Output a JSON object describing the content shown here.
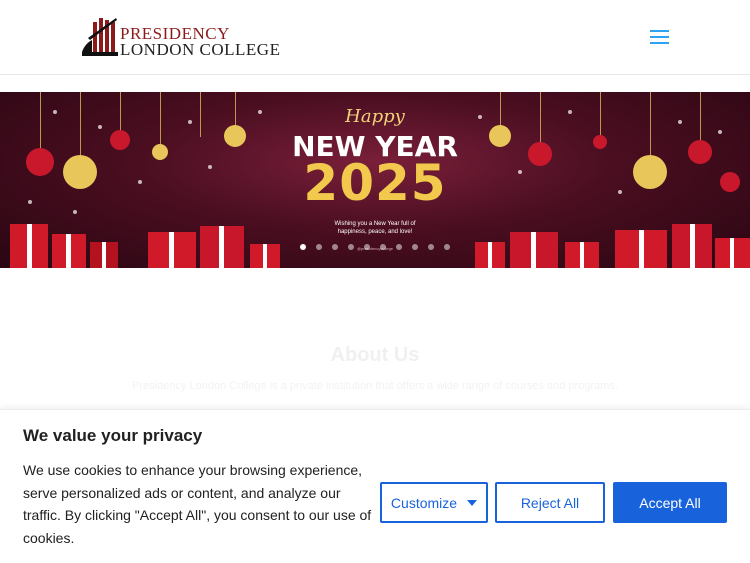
{
  "header": {
    "logo_line1": "PRESIDENCY",
    "logo_line2": "LONDON COLLEGE",
    "menu_icon": "hamburger-menu-icon"
  },
  "slider": {
    "happy": "Happy",
    "new_year": "NEW YEAR",
    "year": "2025",
    "wish_line1": "Wishing you a New Year full of",
    "wish_line2": "happiness, peace, and love!",
    "credit": "@presidencycollege",
    "dots": [
      true,
      false,
      false,
      false,
      false,
      false,
      false,
      false,
      false,
      false
    ]
  },
  "about": {
    "title": "About Us",
    "text": "Presidency London College is a private institution that offers a wide range of courses and programs."
  },
  "cookie": {
    "title": "We value your privacy",
    "body": "We use cookies to enhance your browsing experience, serve personalized ads or content, and analyze our traffic. By clicking \"Accept All\", you consent to our use of cookies.",
    "customize_label": "Customize",
    "reject_label": "Reject All",
    "accept_label": "Accept All"
  },
  "colors": {
    "accent": "#1863dc",
    "menu": "#2ea3f2",
    "logo_red": "#8b1a1a",
    "slide_gold": "#f2c94c",
    "slide_bg": "#4a0e20"
  }
}
